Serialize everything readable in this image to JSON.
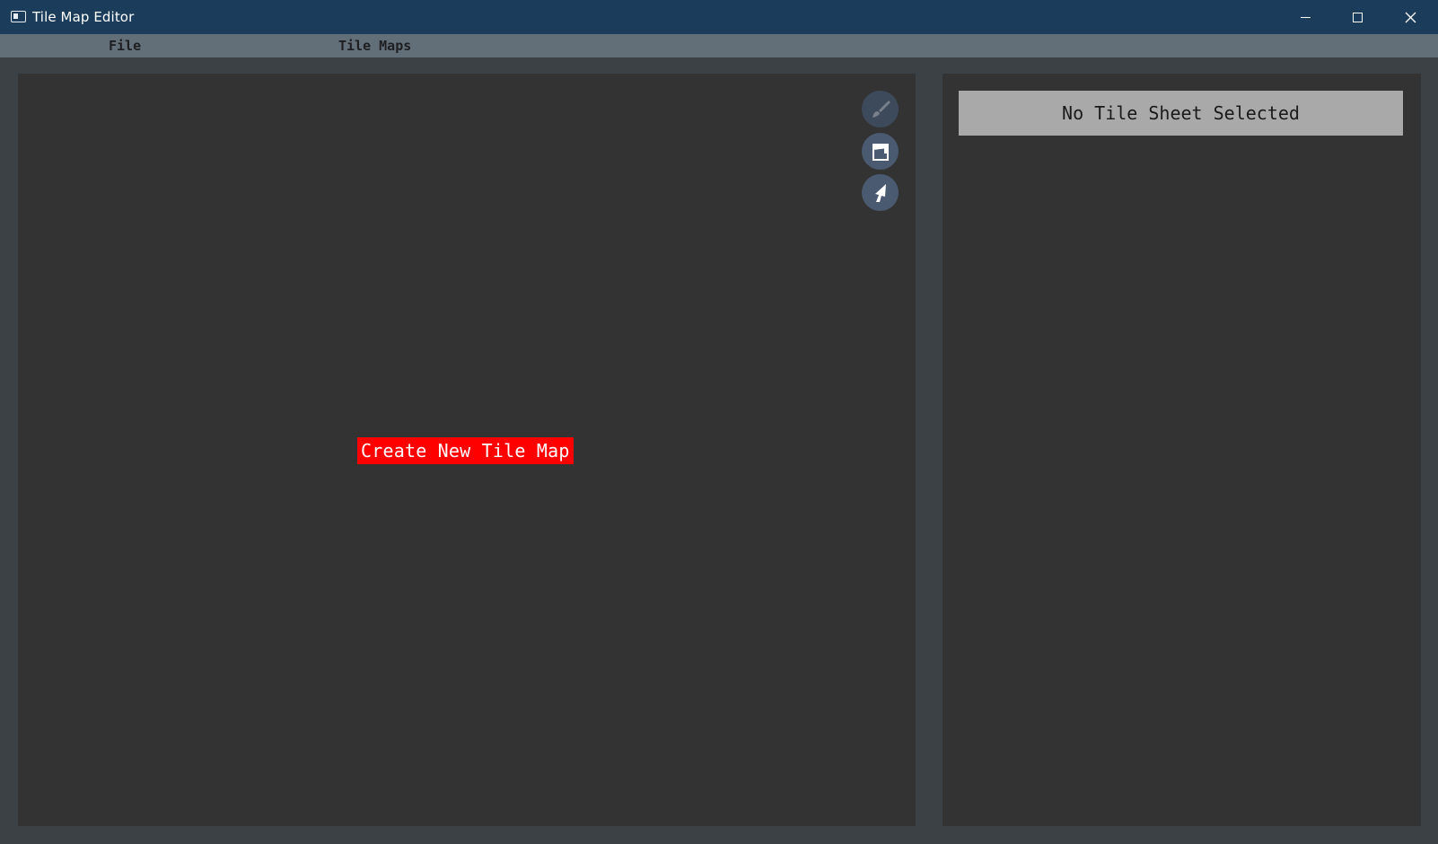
{
  "window": {
    "title": "Tile Map Editor",
    "icon": "app-window-icon",
    "controls": {
      "minimize": "minimize-icon",
      "maximize": "maximize-icon",
      "close": "close-icon"
    }
  },
  "menu": {
    "file": "File",
    "tile_maps": "Tile Maps"
  },
  "map_panel": {
    "tools": [
      {
        "name": "brush",
        "icon": "brush-icon"
      },
      {
        "name": "bucket",
        "icon": "paint-bucket-icon"
      },
      {
        "name": "pointer",
        "icon": "pointer-icon"
      }
    ],
    "create_button": "Create New Tile Map"
  },
  "sheet_panel": {
    "status": "No Tile Sheet Selected"
  },
  "colors": {
    "titlebar": "#1b3d5b",
    "menubar": "#626f78",
    "panel": "#333333",
    "background": "#3b4145",
    "create_button": "#ff0000",
    "tool_button": "#4a5a70",
    "sheet_status": "#a9a9a9"
  }
}
